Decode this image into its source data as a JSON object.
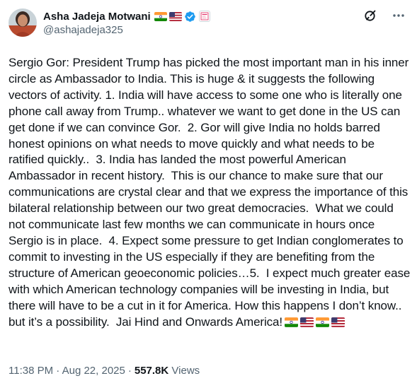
{
  "author": {
    "name": "Asha Jadeja Motwani",
    "handle": "@ashajadeja325",
    "name_flags": [
      "india-flag",
      "us-flag"
    ],
    "verified_badge_color": "#1d9bf0"
  },
  "header_actions": [
    "grok-icon",
    "more-icon"
  ],
  "tweet": {
    "text": "Sergio Gor: President Trump has picked the most important man in his inner circle as Ambassador to India. This is huge & it suggests the following vectors of activity. 1. India will have access to some one who is literally one phone call away from Trump.. whatever we want to get done in the US can get done if we can convince Gor.  2. Gor will give India no holds barred honest opinions on what needs to move quickly and what needs to be ratified quickly..  3. India has landed the most powerful American Ambassador in recent history.  This is our chance to make sure that our communications are crystal clear and that we express the importance of this bilateral relationship between our two great democracies.  What we could not communicate last few months we can communicate in hours once Sergio is in place.  4. Expect some pressure to get Indian conglomerates to commit to investing in the US especially if they are benefiting from the structure of American geoeconomic policies…5.  I expect much greater ease with which American technology companies will be investing in India, but there will have to be a cut in it for America. How this happens I don’t know..  but it’s a possibility.  Jai Hind and Onwards America!",
    "trailing_flags": [
      "india-flag",
      "us-flag",
      "india-flag",
      "us-flag"
    ]
  },
  "meta": {
    "time": "11:38 PM",
    "date": "Aug 22, 2025",
    "separator": "·",
    "views_count": "557.8K",
    "views_label": "Views"
  },
  "colors": {
    "text": "#0f1419",
    "secondary": "#536471",
    "verified": "#1d9bf0"
  }
}
